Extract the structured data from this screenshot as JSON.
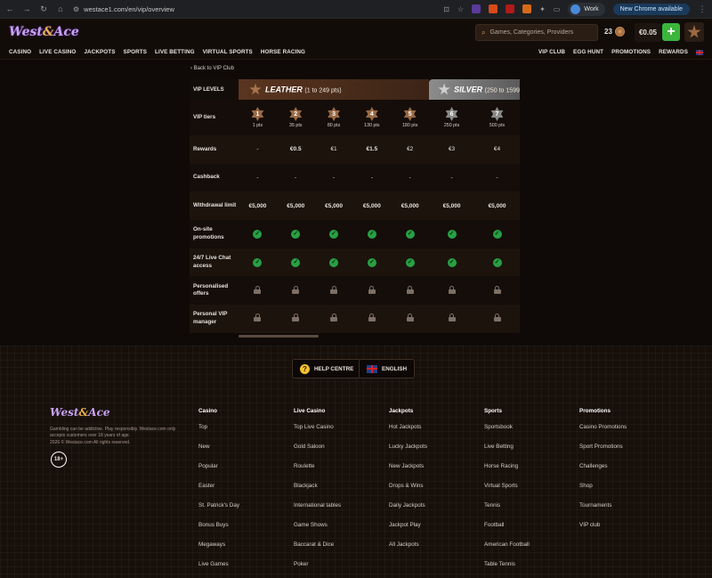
{
  "browser": {
    "url": "westace1.com/en/vip/overview",
    "profile": "Work",
    "update_label": "New Chrome available"
  },
  "header": {
    "logo": {
      "left": "West",
      "amp": "&",
      "right": "Ace"
    },
    "search_placeholder": "Games, Categories, Providers",
    "coins": "23",
    "balance": "€0.05",
    "deposit_symbol": "+"
  },
  "nav": {
    "left": [
      "CASINO",
      "LIVE CASINO",
      "JACKPOTS",
      "SPORTS",
      "LIVE BETTING",
      "VIRTUAL SPORTS",
      "HORSE RACING"
    ],
    "right": [
      "VIP CLUB",
      "EGG HUNT",
      "PROMOTIONS",
      "REWARDS"
    ]
  },
  "vip": {
    "back_link": "Back to VIP Club",
    "levels_label": "VIP LEVELS",
    "groups": [
      {
        "name": "LEATHER",
        "range": "(1 to 249 pts)"
      },
      {
        "name": "SILVER",
        "range": "(250 to 1599"
      }
    ],
    "tiers": [
      {
        "num": "1",
        "pts": "1 pts",
        "kind": "br"
      },
      {
        "num": "2",
        "pts": "35 pts",
        "kind": "br"
      },
      {
        "num": "3",
        "pts": "80 pts",
        "kind": "br"
      },
      {
        "num": "4",
        "pts": "130 pts",
        "kind": "br"
      },
      {
        "num": "5",
        "pts": "180 pts",
        "kind": "br"
      },
      {
        "num": "6",
        "pts": "250 pts",
        "kind": "sv"
      },
      {
        "num": "7",
        "pts": "500 pts",
        "kind": "sv"
      }
    ],
    "rows": [
      {
        "label": "Rewards",
        "values": [
          "-",
          "€0.5",
          "€1",
          "€1.5",
          "€2",
          "€3",
          "€4"
        ]
      },
      {
        "label": "Cashback",
        "values": [
          "-",
          "-",
          "-",
          "-",
          "-",
          "-",
          "-"
        ]
      },
      {
        "label": "Withdrawal limit",
        "values": [
          "€5,000",
          "€5,000",
          "€5,000",
          "€5,000",
          "€5,000",
          "€5,000",
          "€5,000"
        ]
      },
      {
        "label": "On-site promotions",
        "values": [
          "check",
          "check",
          "check",
          "check",
          "check",
          "check",
          "check"
        ]
      },
      {
        "label": "24/7 Live Chat access",
        "values": [
          "check",
          "check",
          "check",
          "check",
          "check",
          "check",
          "check"
        ]
      },
      {
        "label": "Personalised offers",
        "values": [
          "lock",
          "lock",
          "lock",
          "lock",
          "lock",
          "lock",
          "lock"
        ]
      },
      {
        "label": "Personal VIP manager",
        "values": [
          "lock",
          "lock",
          "lock",
          "lock",
          "lock",
          "lock",
          "lock"
        ]
      }
    ],
    "tiers_label": "VIP tiers"
  },
  "footer": {
    "help_label": "HELP CENTRE",
    "lang_label": "ENGLISH",
    "disclaimer": "Gambling can be addictive. Play responsibly. Westace.com only accepts customers over 18 years of age.",
    "copyright": "2026 © Westace.com All rights reserved.",
    "age_badge": "18+",
    "columns": [
      {
        "title": "Casino",
        "items": [
          "Top",
          "New",
          "Popular",
          "Easter",
          "St. Patrick's Day",
          "Bonus Buys",
          "Megaways",
          "Live Games"
        ]
      },
      {
        "title": "Live Casino",
        "items": [
          "Top Live Casino",
          "Gold Saloon",
          "Roulette",
          "Blackjack",
          "International tables",
          "Game Shows",
          "Baccarat & Dice",
          "Poker"
        ]
      },
      {
        "title": "Jackpots",
        "items": [
          "Hot Jackpots",
          "Lucky Jackpots",
          "New Jackpots",
          "Drops & Wins",
          "Daily Jackpots",
          "Jackpot Play",
          "All Jackpots"
        ]
      },
      {
        "title": "Sports",
        "items": [
          "Sportsbook",
          "Live Betting",
          "Horse Racing",
          "Virtual Sports",
          "Tennis",
          "Football",
          "American Football",
          "Table Tennis"
        ]
      },
      {
        "title": "Promotions",
        "items": [
          "Casino Promotions",
          "Sport Promotions",
          "Challenges",
          "Shop",
          "Tournaments",
          "VIP club"
        ]
      }
    ]
  }
}
